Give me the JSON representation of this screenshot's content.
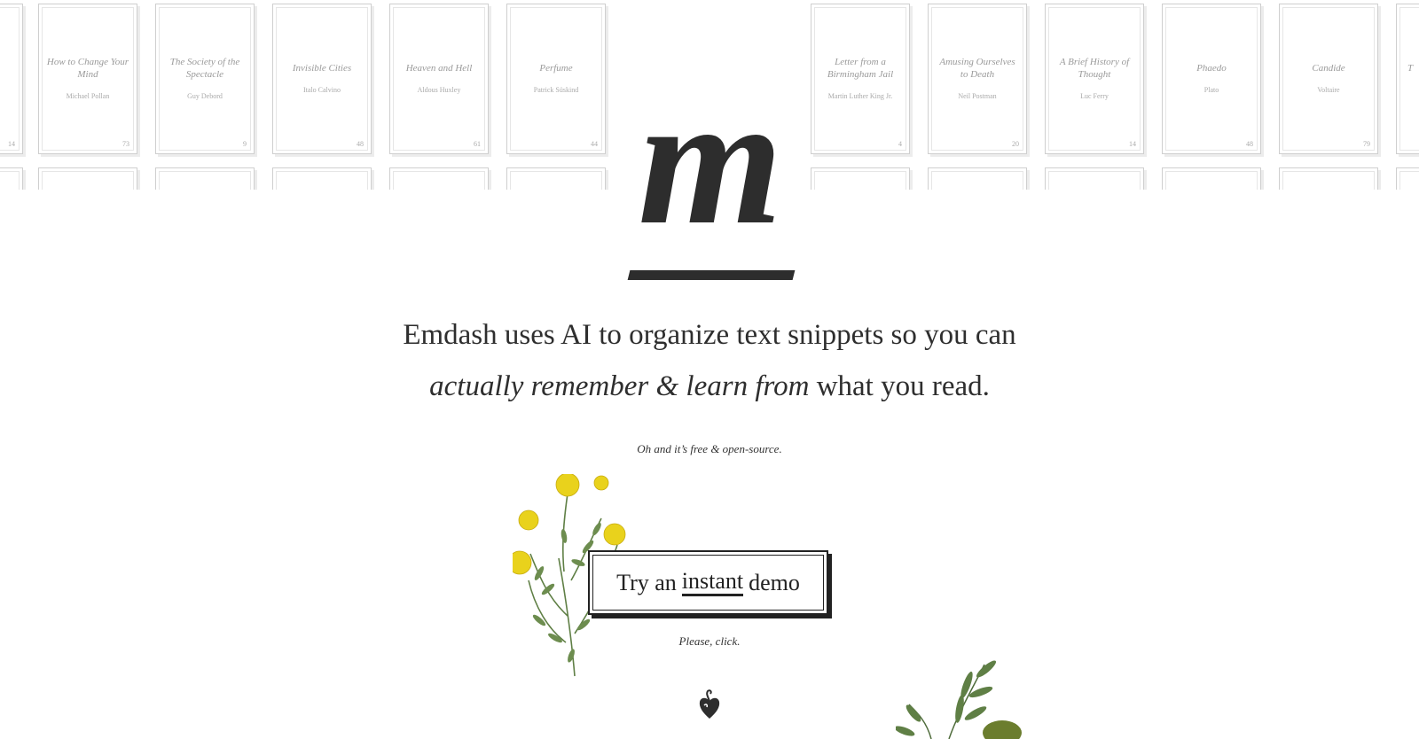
{
  "bookshelf": {
    "row1": [
      {
        "title": "",
        "author": "",
        "number": "14"
      },
      {
        "title": "How to Change Your Mind",
        "author": "Michael Pollan",
        "number": "73"
      },
      {
        "title": "The Society of the Spectacle",
        "author": "Guy Debord",
        "number": "9"
      },
      {
        "title": "Invisible Cities",
        "author": "Italo Calvino",
        "number": "48"
      },
      {
        "title": "Heaven and Hell",
        "author": "Aldous Huxley",
        "number": "61"
      },
      {
        "title": "Perfume",
        "author": "Patrick Süskind",
        "number": "44"
      },
      {
        "title": "Letter from a Birmingham Jail",
        "author": "Martin Luther King Jr.",
        "number": "4"
      },
      {
        "title": "Amusing Ourselves to Death",
        "author": "Neil Postman",
        "number": "20"
      },
      {
        "title": "A Brief History of Thought",
        "author": "Luc Ferry",
        "number": "14"
      },
      {
        "title": "Phaedo",
        "author": "Plato",
        "number": "48"
      },
      {
        "title": "Candide",
        "author": "Voltaire",
        "number": "79"
      },
      {
        "title": "T",
        "author": "",
        "number": ""
      }
    ]
  },
  "logo": {
    "letter": "m"
  },
  "headline": {
    "line1": "Emdash uses AI to organize text snippets so you can",
    "line2_italic": "actually remember & learn from",
    "line2_rest": "what you read."
  },
  "subtext": "Oh and it’s free & open-source.",
  "cta": {
    "pre": "Try an",
    "underlined": "instant",
    "post": "demo"
  },
  "cta_note": "Please, click.",
  "colors": {
    "text": "#2d2d2d",
    "flower": "#e9d21c",
    "leaf": "#5f7f45"
  }
}
